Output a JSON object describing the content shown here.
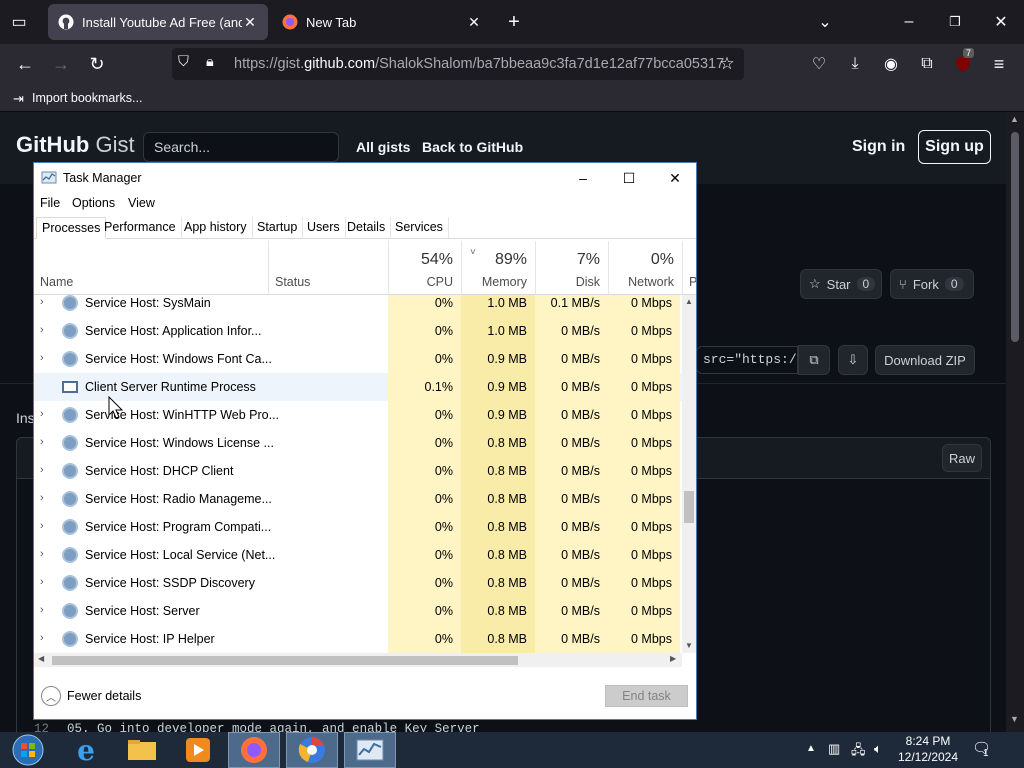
{
  "browser": {
    "tabs": [
      {
        "title": "Install Youtube Ad Free (and other",
        "favicon": "github-icon"
      },
      {
        "title": "New Tab",
        "favicon": "firefox-icon"
      }
    ],
    "url_prefix": "https://gist.",
    "url_domain": "github.com",
    "url_path": "/ShalokShalom/ba7bbeaa9c3fa7d1e12af77bcca05317",
    "bookmark": "Import bookmarks...",
    "extension_badge": "7"
  },
  "gist": {
    "logo_main": "GitHub",
    "logo_sub": "Gist",
    "search_placeholder": "Search...",
    "all_gists": "All gists",
    "back": "Back to GitHub",
    "sign_in": "Sign in",
    "sign_up": "Sign up",
    "star_label": "Star",
    "star_count": "0",
    "fork_label": "Fork",
    "fork_count": "0",
    "embed_value": "src=\"https:/",
    "download_zip": "Download ZIP",
    "raw": "Raw",
    "ins_text": "Ins",
    "code_line_num": "12",
    "code_line_text": "05. Go into developer mode again, and enable Key Server"
  },
  "task_manager": {
    "title": "Task Manager",
    "menu": [
      "File",
      "Options",
      "View"
    ],
    "tabs": [
      "Processes",
      "Performance",
      "App history",
      "Startup",
      "Users",
      "Details",
      "Services"
    ],
    "columns": {
      "name": "Name",
      "status": "Status",
      "cpu_pct": "54%",
      "cpu": "CPU",
      "mem_pct": "89%",
      "mem": "Memory",
      "disk_pct": "7%",
      "disk": "Disk",
      "net_pct": "0%",
      "net": "Network",
      "power": "P"
    },
    "rows": [
      {
        "name": "Service Host: SysMain",
        "cpu": "0%",
        "mem": "1.0 MB",
        "disk": "0.1 MB/s",
        "net": "0 Mbps",
        "icon": "gear-icon",
        "expand": true
      },
      {
        "name": "Service Host: Application Infor...",
        "cpu": "0%",
        "mem": "1.0 MB",
        "disk": "0 MB/s",
        "net": "0 Mbps",
        "icon": "gear-icon",
        "expand": true
      },
      {
        "name": "Service Host: Windows Font Ca...",
        "cpu": "0%",
        "mem": "0.9 MB",
        "disk": "0 MB/s",
        "net": "0 Mbps",
        "icon": "gear-icon",
        "expand": true
      },
      {
        "name": "Client Server Runtime Process",
        "cpu": "0.1%",
        "mem": "0.9 MB",
        "disk": "0 MB/s",
        "net": "0 Mbps",
        "icon": "window-icon",
        "expand": false
      },
      {
        "name": "Service Host: WinHTTP Web Pro...",
        "cpu": "0%",
        "mem": "0.9 MB",
        "disk": "0 MB/s",
        "net": "0 Mbps",
        "icon": "gear-icon",
        "expand": true
      },
      {
        "name": "Service Host: Windows License ...",
        "cpu": "0%",
        "mem": "0.8 MB",
        "disk": "0 MB/s",
        "net": "0 Mbps",
        "icon": "gear-icon",
        "expand": true
      },
      {
        "name": "Service Host: DHCP Client",
        "cpu": "0%",
        "mem": "0.8 MB",
        "disk": "0 MB/s",
        "net": "0 Mbps",
        "icon": "gear-icon",
        "expand": true
      },
      {
        "name": "Service Host: Radio Manageme...",
        "cpu": "0%",
        "mem": "0.8 MB",
        "disk": "0 MB/s",
        "net": "0 Mbps",
        "icon": "gear-icon",
        "expand": true
      },
      {
        "name": "Service Host: Program Compati...",
        "cpu": "0%",
        "mem": "0.8 MB",
        "disk": "0 MB/s",
        "net": "0 Mbps",
        "icon": "gear-icon",
        "expand": true
      },
      {
        "name": "Service Host: Local Service (Net...",
        "cpu": "0%",
        "mem": "0.8 MB",
        "disk": "0 MB/s",
        "net": "0 Mbps",
        "icon": "gear-icon",
        "expand": true
      },
      {
        "name": "Service Host: SSDP Discovery",
        "cpu": "0%",
        "mem": "0.8 MB",
        "disk": "0 MB/s",
        "net": "0 Mbps",
        "icon": "gear-icon",
        "expand": true
      },
      {
        "name": "Service Host: Server",
        "cpu": "0%",
        "mem": "0.8 MB",
        "disk": "0 MB/s",
        "net": "0 Mbps",
        "icon": "gear-icon",
        "expand": true
      },
      {
        "name": "Service Host: IP Helper",
        "cpu": "0%",
        "mem": "0.8 MB",
        "disk": "0 MB/s",
        "net": "0 Mbps",
        "icon": "gear-icon",
        "expand": true
      }
    ],
    "fewer_details": "Fewer details",
    "end_task": "End task"
  },
  "taskbar": {
    "time": "8:24 PM",
    "date": "12/12/2024",
    "notification_count": "1",
    "apps": [
      "start-orb-icon",
      "internet-explorer-icon",
      "file-explorer-icon",
      "media-player-icon",
      "firefox-icon",
      "chromium-icon",
      "task-manager-icon"
    ]
  }
}
